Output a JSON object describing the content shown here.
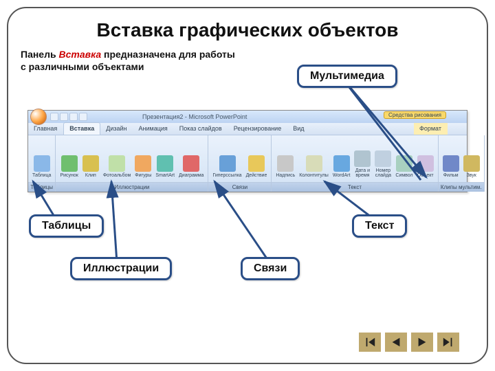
{
  "title": "Вставка графических объектов",
  "desc": {
    "pre": "Панель ",
    "hl": "Вставка",
    "post": " предназначена для работы с различными объектами"
  },
  "titlebar": {
    "text": "Презентация2 - Microsoft PowerPoint",
    "context": "Средства рисования"
  },
  "tabs": [
    "Главная",
    "Вставка",
    "Дизайн",
    "Анимация",
    "Показ слайдов",
    "Рецензирование",
    "Вид"
  ],
  "ctxtab": "Формат",
  "groups": [
    {
      "label": "Таблицы",
      "items": [
        {
          "n": "Таблица",
          "c": "#8ab8e8"
        }
      ]
    },
    {
      "label": "Иллюстрации",
      "items": [
        {
          "n": "Рисунок",
          "c": "#6fbf6f"
        },
        {
          "n": "Клип",
          "c": "#d8c050"
        },
        {
          "n": "Фотоальбом",
          "c": "#c0e0a8"
        },
        {
          "n": "Фигуры",
          "c": "#f0a860"
        },
        {
          "n": "SmartArt",
          "c": "#60c0b0"
        },
        {
          "n": "Диаграмма",
          "c": "#e06868"
        }
      ]
    },
    {
      "label": "Связи",
      "items": [
        {
          "n": "Гиперссылка",
          "c": "#68a0d8"
        },
        {
          "n": "Действие",
          "c": "#e8c85a"
        }
      ]
    },
    {
      "label": "Текст",
      "items": [
        {
          "n": "Надпись",
          "c": "#c8c8c8"
        },
        {
          "n": "Колонтитулы",
          "c": "#d8dcb8"
        },
        {
          "n": "WordArt",
          "c": "#68a8e0"
        },
        {
          "n": "Дата и время",
          "c": "#b0c4d0"
        },
        {
          "n": "Номер слайда",
          "c": "#c0d0e0"
        },
        {
          "n": "Символ",
          "c": "#a8d0c0"
        },
        {
          "n": "Объект",
          "c": "#d0c0e0"
        }
      ]
    },
    {
      "label": "Клипы мультим.",
      "items": [
        {
          "n": "Фильм",
          "c": "#7088c8"
        },
        {
          "n": "Звук",
          "c": "#d0b860"
        }
      ]
    }
  ],
  "callouts": {
    "multimedia": "Мультимедиа",
    "tables": "Таблицы",
    "text": "Текст",
    "illustrations": "Иллюстрации",
    "links": "Связи"
  }
}
